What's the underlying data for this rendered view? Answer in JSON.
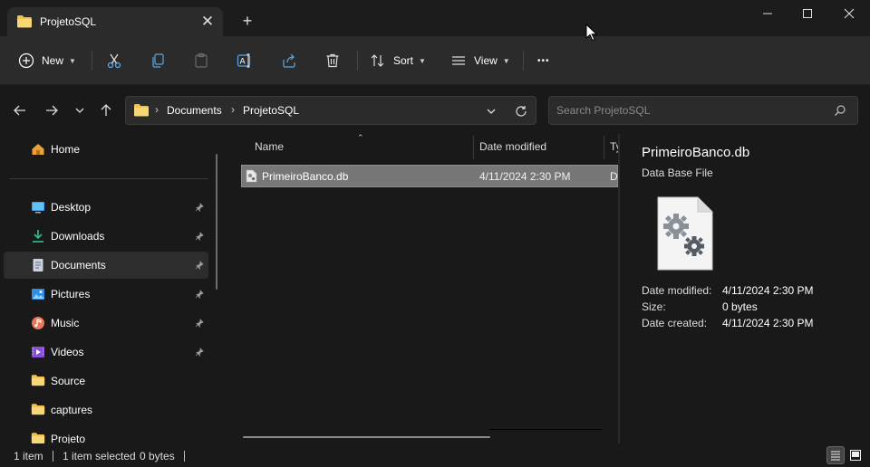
{
  "window": {
    "tab_title": "ProjetoSQL",
    "tab_close_symbol": "✕",
    "new_tab_symbol": "+"
  },
  "toolbar": {
    "new_label": "New",
    "sort_label": "Sort",
    "view_label": "View",
    "more_symbol": "•••"
  },
  "address": {
    "breadcrumbs": [
      "Documents",
      "ProjetoSQL"
    ],
    "separator": "›"
  },
  "search": {
    "placeholder": "Search ProjetoSQL"
  },
  "sidebar": {
    "items": [
      {
        "label": "Home",
        "icon": "home-icon",
        "pinned": false
      },
      {
        "label": "Desktop",
        "icon": "desktop-icon",
        "pinned": true
      },
      {
        "label": "Downloads",
        "icon": "downloads-icon",
        "pinned": true
      },
      {
        "label": "Documents",
        "icon": "documents-icon",
        "pinned": true,
        "selected": true
      },
      {
        "label": "Pictures",
        "icon": "pictures-icon",
        "pinned": true
      },
      {
        "label": "Music",
        "icon": "music-icon",
        "pinned": true
      },
      {
        "label": "Videos",
        "icon": "videos-icon",
        "pinned": true
      },
      {
        "label": "Source",
        "icon": "folder-icon",
        "pinned": false
      },
      {
        "label": "captures",
        "icon": "folder-icon",
        "pinned": false
      },
      {
        "label": "Projeto",
        "icon": "folder-icon",
        "pinned": false
      }
    ]
  },
  "filelist": {
    "columns": {
      "name": "Name",
      "date": "Date modified",
      "type": "Ty"
    },
    "rows": [
      {
        "name": "PrimeiroBanco.db",
        "date": "4/11/2024 2:30 PM",
        "type": "D",
        "selected": true
      }
    ]
  },
  "details": {
    "title": "PrimeiroBanco.db",
    "subtitle": "Data Base File",
    "fields": [
      {
        "label": "Date modified:",
        "value": "4/11/2024 2:30 PM"
      },
      {
        "label": "Size:",
        "value": "0 bytes"
      },
      {
        "label": "Date created:",
        "value": "4/11/2024 2:30 PM"
      }
    ]
  },
  "status": {
    "count": "1 item",
    "selection": "1 item selected",
    "size": "0 bytes"
  },
  "colors": {
    "background": "#191919",
    "toolbar": "#2b2b2b",
    "selected_row": "#777777",
    "folder": "#f2c14e"
  }
}
